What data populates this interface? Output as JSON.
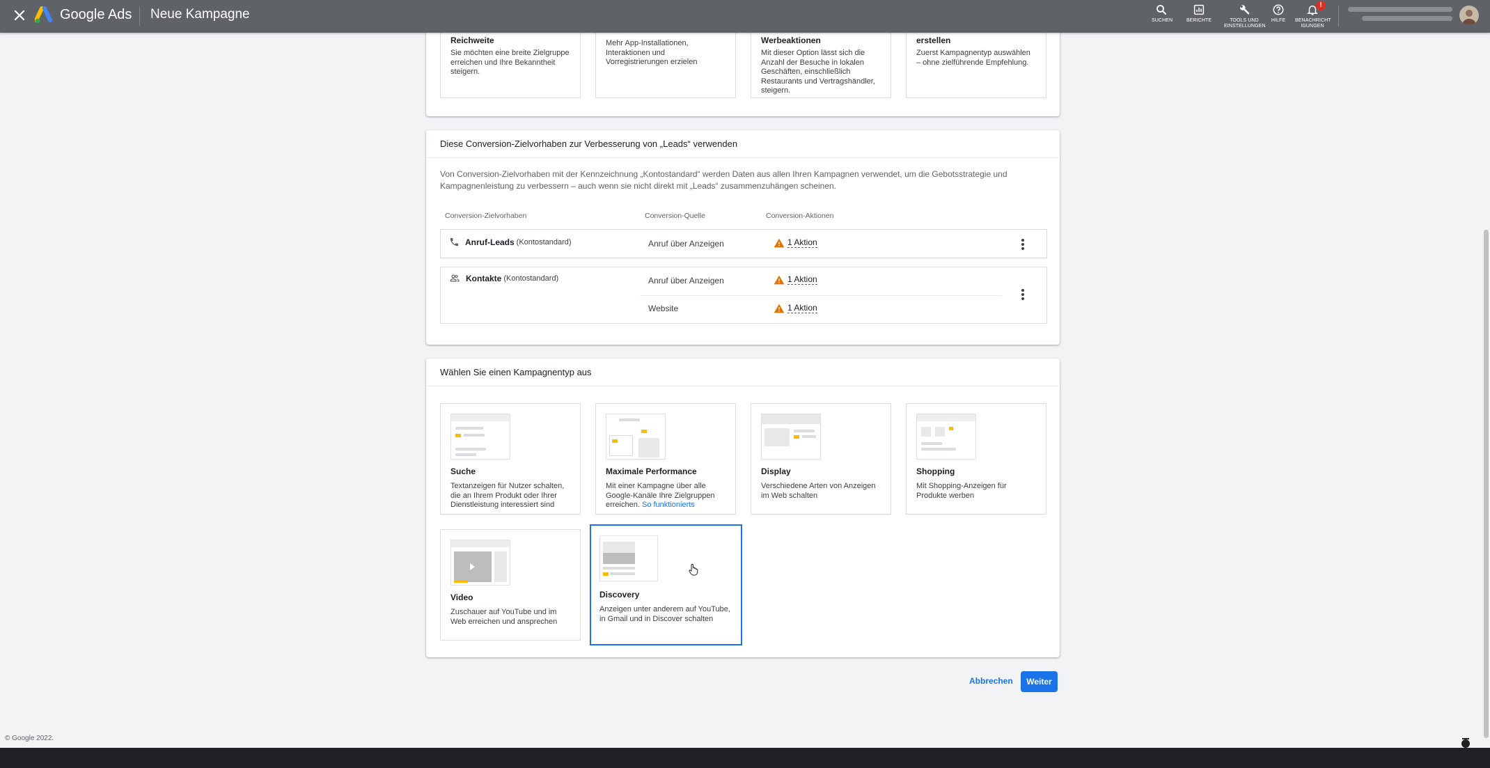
{
  "topbar": {
    "app_name": "Google Ads",
    "page_title": "Neue Kampagne",
    "tools": [
      {
        "label": "SUCHEN"
      },
      {
        "label": "BERICHTE"
      },
      {
        "label": "TOOLS UND\nEINSTELLUNGEN"
      },
      {
        "label": "HILFE"
      },
      {
        "label": "BENACHRICHT\nIGUNGEN"
      }
    ],
    "notification_badge": "!"
  },
  "goals": [
    {
      "title": "Reichweite",
      "description": "Sie möchten eine breite Zielgruppe erreichen und Ihre Bekanntheit steigern."
    },
    {
      "title": "",
      "description": "Mehr App-Installationen, Interaktionen und Vorregistrierungen erzielen"
    },
    {
      "title": "Werbeaktionen",
      "description": "Mit dieser Option lässt sich die Anzahl der Besuche in lokalen Geschäften, einschließlich Restaurants und Vertragshändler, steigern."
    },
    {
      "title": "erstellen",
      "description": "Zuerst Kampagnentyp auswählen – ohne zielführende Empfehlung."
    }
  ],
  "conversion": {
    "title": "Diese Conversion-Zielvorhaben zur Verbesserung von „Leads“ verwenden",
    "description": "Von Conversion-Zielvorhaben mit der Kennzeichnung „Kontostandard“ werden Daten aus allen Ihren Kampagnen verwendet, um die Gebotsstrategie und Kampagnenleistung zu verbessern – auch wenn sie nicht direkt mit „Leads“ zusammenzuhängen scheinen.",
    "columns": [
      "Conversion-Zielvorhaben",
      "Conversion-Quelle",
      "Conversion-Aktionen"
    ],
    "rows": [
      {
        "name": "Anruf-Leads",
        "tag": "(Kontostandard)",
        "sources": [
          {
            "source": "Anruf über Anzeigen",
            "action": "1 Aktion"
          }
        ]
      },
      {
        "name": "Kontakte",
        "tag": "(Kontostandard)",
        "sources": [
          {
            "source": "Anruf über Anzeigen",
            "action": "1 Aktion"
          },
          {
            "source": "Website",
            "action": "1 Aktion"
          }
        ]
      }
    ]
  },
  "campaign_types": {
    "title": "Wählen Sie einen Kampagnentyp aus",
    "items": [
      {
        "title": "Suche",
        "description": "Textanzeigen für Nutzer schalten, die an Ihrem Produkt oder Ihrer Dienstleistung interessiert sind"
      },
      {
        "title": "Maximale Performance",
        "description": "Mit einer Kampagne über alle Google-Kanäle Ihre Zielgruppen erreichen.",
        "link": "So funktionierts"
      },
      {
        "title": "Display",
        "description": "Verschiedene Arten von Anzeigen im Web schalten"
      },
      {
        "title": "Shopping",
        "description": "Mit Shopping-Anzeigen für Produkte werben"
      },
      {
        "title": "Video",
        "description": "Zuschauer auf YouTube und im Web erreichen und ansprechen"
      },
      {
        "title": "Discovery",
        "description": "Anzeigen unter anderem auf YouTube, in Gmail und in Discover schalten",
        "selected": true
      }
    ]
  },
  "actions": {
    "cancel": "Abbrechen",
    "next": "Weiter"
  },
  "footer": "© Google 2022.",
  "colors": {
    "accent": "#1a73e8",
    "topbar": "#5f6368",
    "warning": "#e37400",
    "highlight": "#fbbc04"
  }
}
